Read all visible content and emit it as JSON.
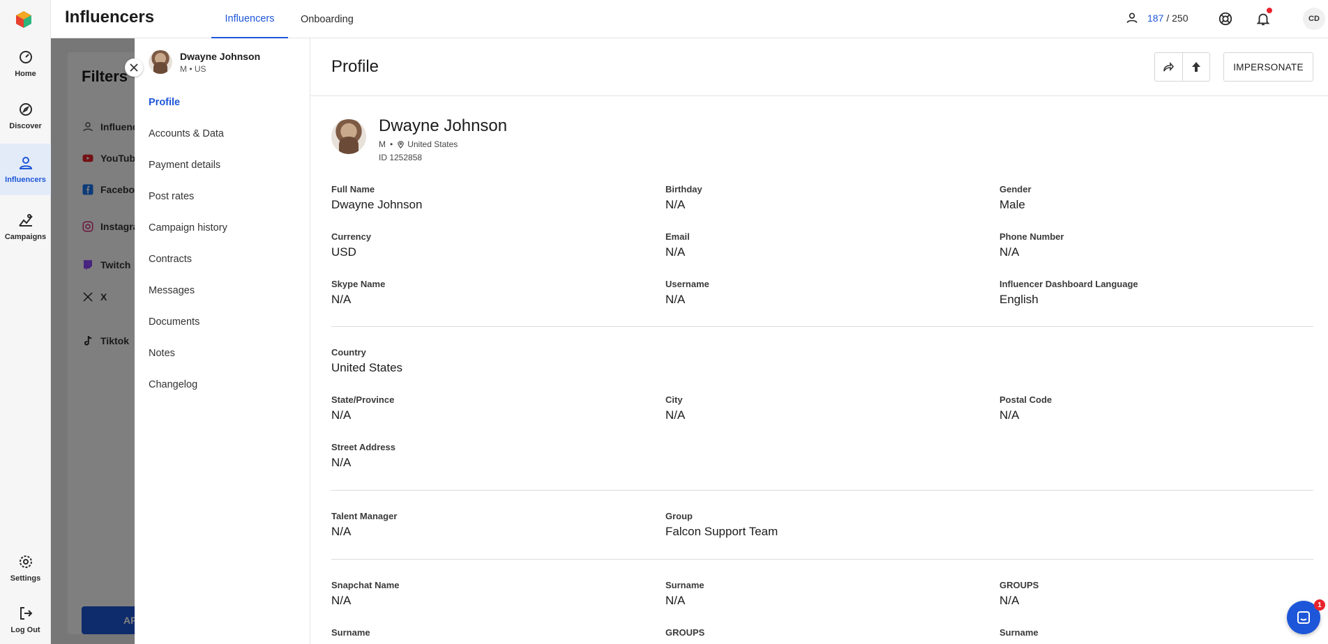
{
  "app": {
    "title": "Influencers"
  },
  "rail": [
    {
      "label": "Home",
      "icon": "home-gauge-icon"
    },
    {
      "label": "Discover",
      "icon": "discover-compass-icon"
    },
    {
      "label": "Influencers",
      "icon": "person-icon",
      "active": true
    },
    {
      "label": "Campaigns",
      "icon": "campaigns-icon"
    },
    {
      "label": "Settings",
      "icon": "gear-icon"
    },
    {
      "label": "Log Out",
      "icon": "logout-icon"
    }
  ],
  "top_tabs": [
    {
      "label": "Influencers",
      "active": true
    },
    {
      "label": "Onboarding",
      "active": false
    }
  ],
  "seats": {
    "used": "187",
    "total": "/ 250"
  },
  "user_initials": "CD",
  "background": {
    "filters_title": "Filters",
    "filter_rows": [
      "Influenc",
      "YouTub",
      "Faceboo",
      "Instagra",
      "Twitch",
      "X",
      "Tiktok"
    ],
    "apply_label": "AP"
  },
  "drawer": {
    "person": {
      "name": "Dwayne Johnson",
      "gender": "M",
      "country_code": "US"
    },
    "nav": [
      "Profile",
      "Accounts & Data",
      "Payment details",
      "Post rates",
      "Campaign history",
      "Contracts",
      "Messages",
      "Documents",
      "Notes",
      "Changelog"
    ],
    "active_nav": "Profile"
  },
  "profile": {
    "title": "Profile",
    "impersonate_label": "IMPERSONATE",
    "name": "Dwayne Johnson",
    "gender": "M",
    "location": "United States",
    "id_text": "ID 1252858",
    "sections": [
      [
        {
          "label": "Full Name",
          "value": "Dwayne Johnson"
        },
        {
          "label": "Birthday",
          "value": "N/A"
        },
        {
          "label": "Gender",
          "value": "Male"
        },
        {
          "label": "Currency",
          "value": "USD"
        },
        {
          "label": "Email",
          "value": "N/A"
        },
        {
          "label": "Phone Number",
          "value": "N/A"
        },
        {
          "label": "Skype Name",
          "value": "N/A"
        },
        {
          "label": "Username",
          "value": "N/A"
        },
        {
          "label": "Influencer Dashboard Language",
          "value": "English"
        }
      ],
      [
        {
          "label": "Country",
          "value": "United States"
        },
        {
          "label": "State/Province",
          "value": "N/A"
        },
        {
          "label": "City",
          "value": "N/A"
        },
        {
          "label": "Postal Code",
          "value": "N/A"
        },
        {
          "label": "Street Address",
          "value": "N/A"
        }
      ],
      [
        {
          "label": "Talent Manager",
          "value": "N/A"
        },
        {
          "label": "Group",
          "value": "Falcon Support Team"
        }
      ],
      [
        {
          "label": "Snapchat Name",
          "value": "N/A"
        },
        {
          "label": "Surname",
          "value": "N/A"
        },
        {
          "label": "GROUPS",
          "value": "N/A"
        },
        {
          "label": "Surname",
          "value": ""
        },
        {
          "label": "GROUPS",
          "value": ""
        },
        {
          "label": "Surname",
          "value": ""
        }
      ]
    ]
  },
  "chat": {
    "badge": "1"
  },
  "colors": {
    "accent": "#1d56d8",
    "alert": "#e8232b"
  }
}
